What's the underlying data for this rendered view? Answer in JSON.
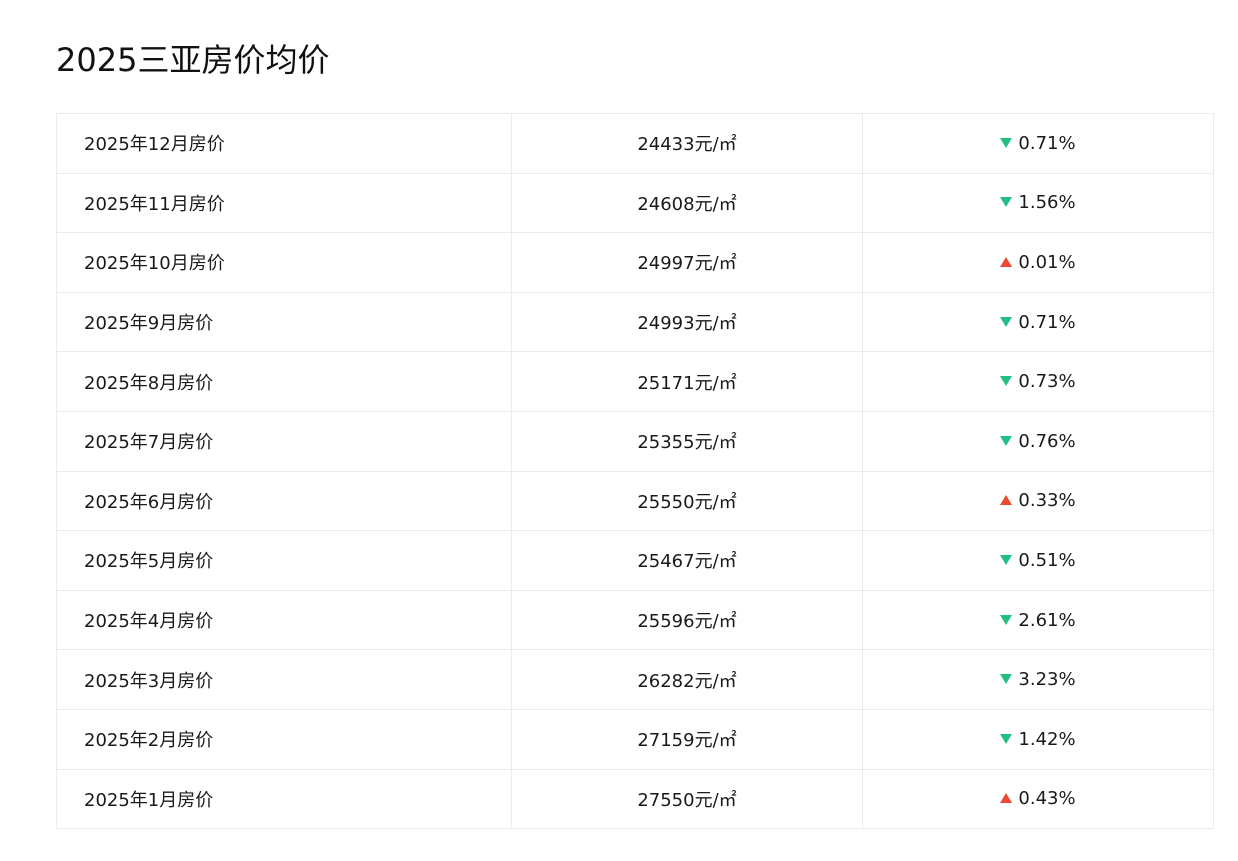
{
  "page": {
    "title": "2025三亚房价均价"
  },
  "colors": {
    "down": "#20c083",
    "up": "#ee4a2f"
  },
  "rows": [
    {
      "month": "2025年12月房价",
      "price": "24433元/㎡",
      "direction": "down",
      "arrow_icon": "triangle-down-icon",
      "change": "0.71%"
    },
    {
      "month": "2025年11月房价",
      "price": "24608元/㎡",
      "direction": "down",
      "arrow_icon": "triangle-down-icon",
      "change": "1.56%"
    },
    {
      "month": "2025年10月房价",
      "price": "24997元/㎡",
      "direction": "up",
      "arrow_icon": "triangle-up-icon",
      "change": "0.01%"
    },
    {
      "month": "2025年9月房价",
      "price": "24993元/㎡",
      "direction": "down",
      "arrow_icon": "triangle-down-icon",
      "change": "0.71%"
    },
    {
      "month": "2025年8月房价",
      "price": "25171元/㎡",
      "direction": "down",
      "arrow_icon": "triangle-down-icon",
      "change": "0.73%"
    },
    {
      "month": "2025年7月房价",
      "price": "25355元/㎡",
      "direction": "down",
      "arrow_icon": "triangle-down-icon",
      "change": "0.76%"
    },
    {
      "month": "2025年6月房价",
      "price": "25550元/㎡",
      "direction": "up",
      "arrow_icon": "triangle-up-icon",
      "change": "0.33%"
    },
    {
      "month": "2025年5月房价",
      "price": "25467元/㎡",
      "direction": "down",
      "arrow_icon": "triangle-down-icon",
      "change": "0.51%"
    },
    {
      "month": "2025年4月房价",
      "price": "25596元/㎡",
      "direction": "down",
      "arrow_icon": "triangle-down-icon",
      "change": "2.61%"
    },
    {
      "month": "2025年3月房价",
      "price": "26282元/㎡",
      "direction": "down",
      "arrow_icon": "triangle-down-icon",
      "change": "3.23%"
    },
    {
      "month": "2025年2月房价",
      "price": "27159元/㎡",
      "direction": "down",
      "arrow_icon": "triangle-down-icon",
      "change": "1.42%"
    },
    {
      "month": "2025年1月房价",
      "price": "27550元/㎡",
      "direction": "up",
      "arrow_icon": "triangle-up-icon",
      "change": "0.43%"
    }
  ]
}
